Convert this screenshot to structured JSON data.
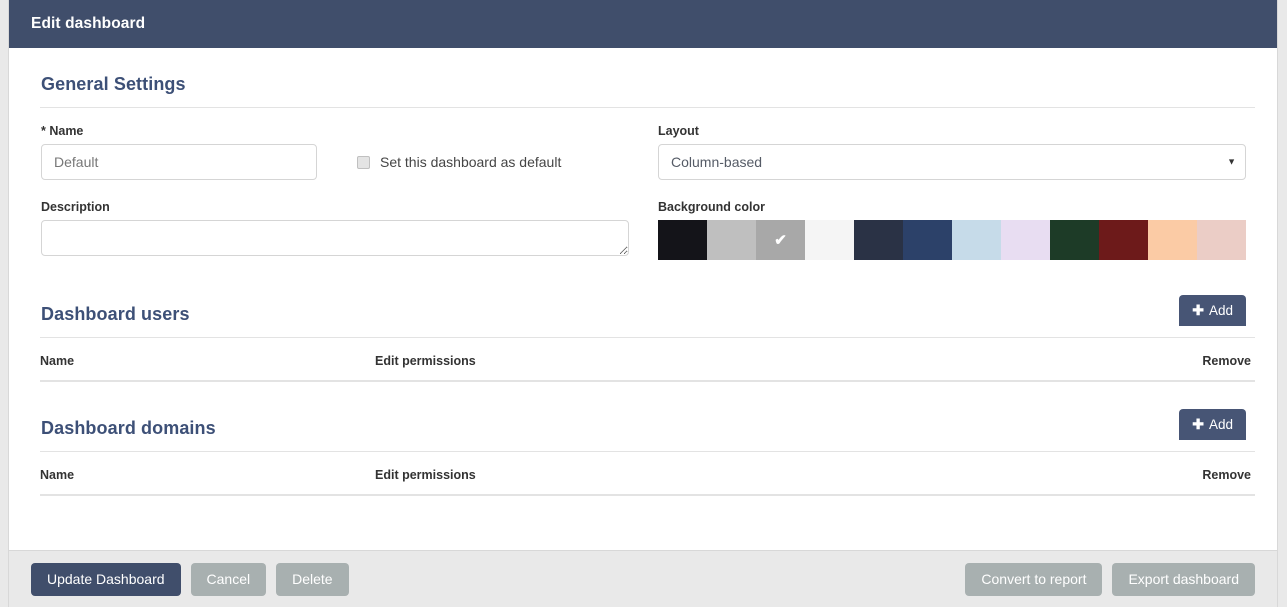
{
  "header": {
    "title": "Edit dashboard"
  },
  "general": {
    "section_title": "General Settings",
    "name_label": "* Name",
    "name_value": "Default",
    "name_placeholder": "Default",
    "default_checkbox_label": "Set this dashboard as default",
    "default_checkbox_checked": false,
    "description_label": "Description",
    "description_value": "",
    "description_placeholder": "",
    "layout_label": "Layout",
    "layout_value": "Column-based",
    "layout_caret": "▼",
    "background_label": "Background color",
    "selected_swatch_index": 2,
    "selected_swatch_tick": "✔",
    "swatches": [
      "#141419",
      "#bfbfbf",
      "#a8a8a8",
      "#f5f5f5",
      "#2a3245",
      "#2c4169",
      "#c6dbe9",
      "#e8ddf2",
      "#1d3b27",
      "#6d1a1a",
      "#fbcba5",
      "#ebcdc6"
    ]
  },
  "users": {
    "section_title": "Dashboard users",
    "add_label": "Add",
    "add_icon": "plus-icon",
    "add_glyph": "✚",
    "columns": [
      "Name",
      "Edit permissions",
      "Remove"
    ],
    "rows": []
  },
  "domains": {
    "section_title": "Dashboard domains",
    "add_label": "Add",
    "add_icon": "plus-icon",
    "add_glyph": "✚",
    "columns": [
      "Name",
      "Edit permissions",
      "Remove"
    ],
    "rows": []
  },
  "footer": {
    "update_label": "Update Dashboard",
    "cancel_label": "Cancel",
    "delete_label": "Delete",
    "convert_label": "Convert to report",
    "export_label": "Export dashboard"
  },
  "colors": {
    "header_bg": "#404e6b",
    "primary_btn": "#404e6b",
    "muted_btn": "#a8b0b0",
    "add_btn": "#475575",
    "section_heading": "#3d5077",
    "footer_bg": "#e9e9e9"
  }
}
